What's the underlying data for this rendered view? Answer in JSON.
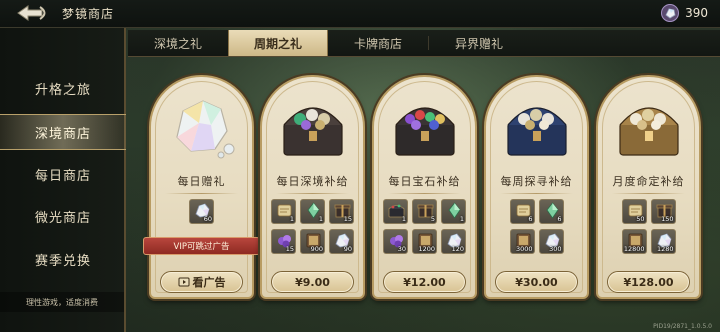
{
  "header": {
    "title": "梦镜商店",
    "currency_value": "390"
  },
  "tabs": [
    {
      "label": "深境之礼"
    },
    {
      "label": "周期之礼"
    },
    {
      "label": "卡牌商店"
    },
    {
      "label": "异界赠礼"
    }
  ],
  "sidebar": {
    "items": [
      {
        "label": "升格之旅"
      },
      {
        "label": "深境商店"
      },
      {
        "label": "每日商店"
      },
      {
        "label": "微光商店"
      },
      {
        "label": "赛季兑换"
      }
    ],
    "footer": "理性游戏，适度消费"
  },
  "cards": [
    {
      "name": "每日赠礼",
      "items": [
        {
          "icon": "gem-cluster-icon",
          "count": "60"
        }
      ],
      "vip_banner": "VIP可跳过广告",
      "button": "看广告"
    },
    {
      "name": "每日深境补给",
      "items": [
        {
          "icon": "scroll-icon",
          "count": "1"
        },
        {
          "icon": "green-crystal-icon",
          "count": "1"
        },
        {
          "icon": "gift-box-icon",
          "count": "15"
        },
        {
          "icon": "purple-gem-icon",
          "count": "15"
        },
        {
          "icon": "book-icon",
          "count": "900"
        },
        {
          "icon": "gem-cluster-icon",
          "count": "90"
        }
      ],
      "button": "¥9.00"
    },
    {
      "name": "每日宝石补给",
      "items": [
        {
          "icon": "dark-chest-icon",
          "count": "1"
        },
        {
          "icon": "gift-box-icon",
          "count": "5"
        },
        {
          "icon": "green-crystal-icon",
          "count": "1"
        },
        {
          "icon": "purple-gem-icon",
          "count": "30"
        },
        {
          "icon": "book-icon",
          "count": "1200"
        },
        {
          "icon": "gem-cluster-icon",
          "count": "120"
        }
      ],
      "button": "¥12.00"
    },
    {
      "name": "每周探寻补给",
      "items": [
        {
          "icon": "scroll-icon",
          "count": "6"
        },
        {
          "icon": "green-crystal-icon",
          "count": "6"
        },
        {
          "icon": "book-icon",
          "count": "3000"
        },
        {
          "icon": "gem-cluster-icon",
          "count": "300"
        }
      ],
      "button": "¥30.00"
    },
    {
      "name": "月度命定补给",
      "items": [
        {
          "icon": "scroll-icon",
          "count": "50"
        },
        {
          "icon": "gift-box-icon",
          "count": "150"
        },
        {
          "icon": "book-icon",
          "count": "12800"
        },
        {
          "icon": "gem-cluster-icon",
          "count": "1280"
        }
      ],
      "button": "¥128.00"
    }
  ],
  "version": "PID19/2871_1.0.5.0"
}
